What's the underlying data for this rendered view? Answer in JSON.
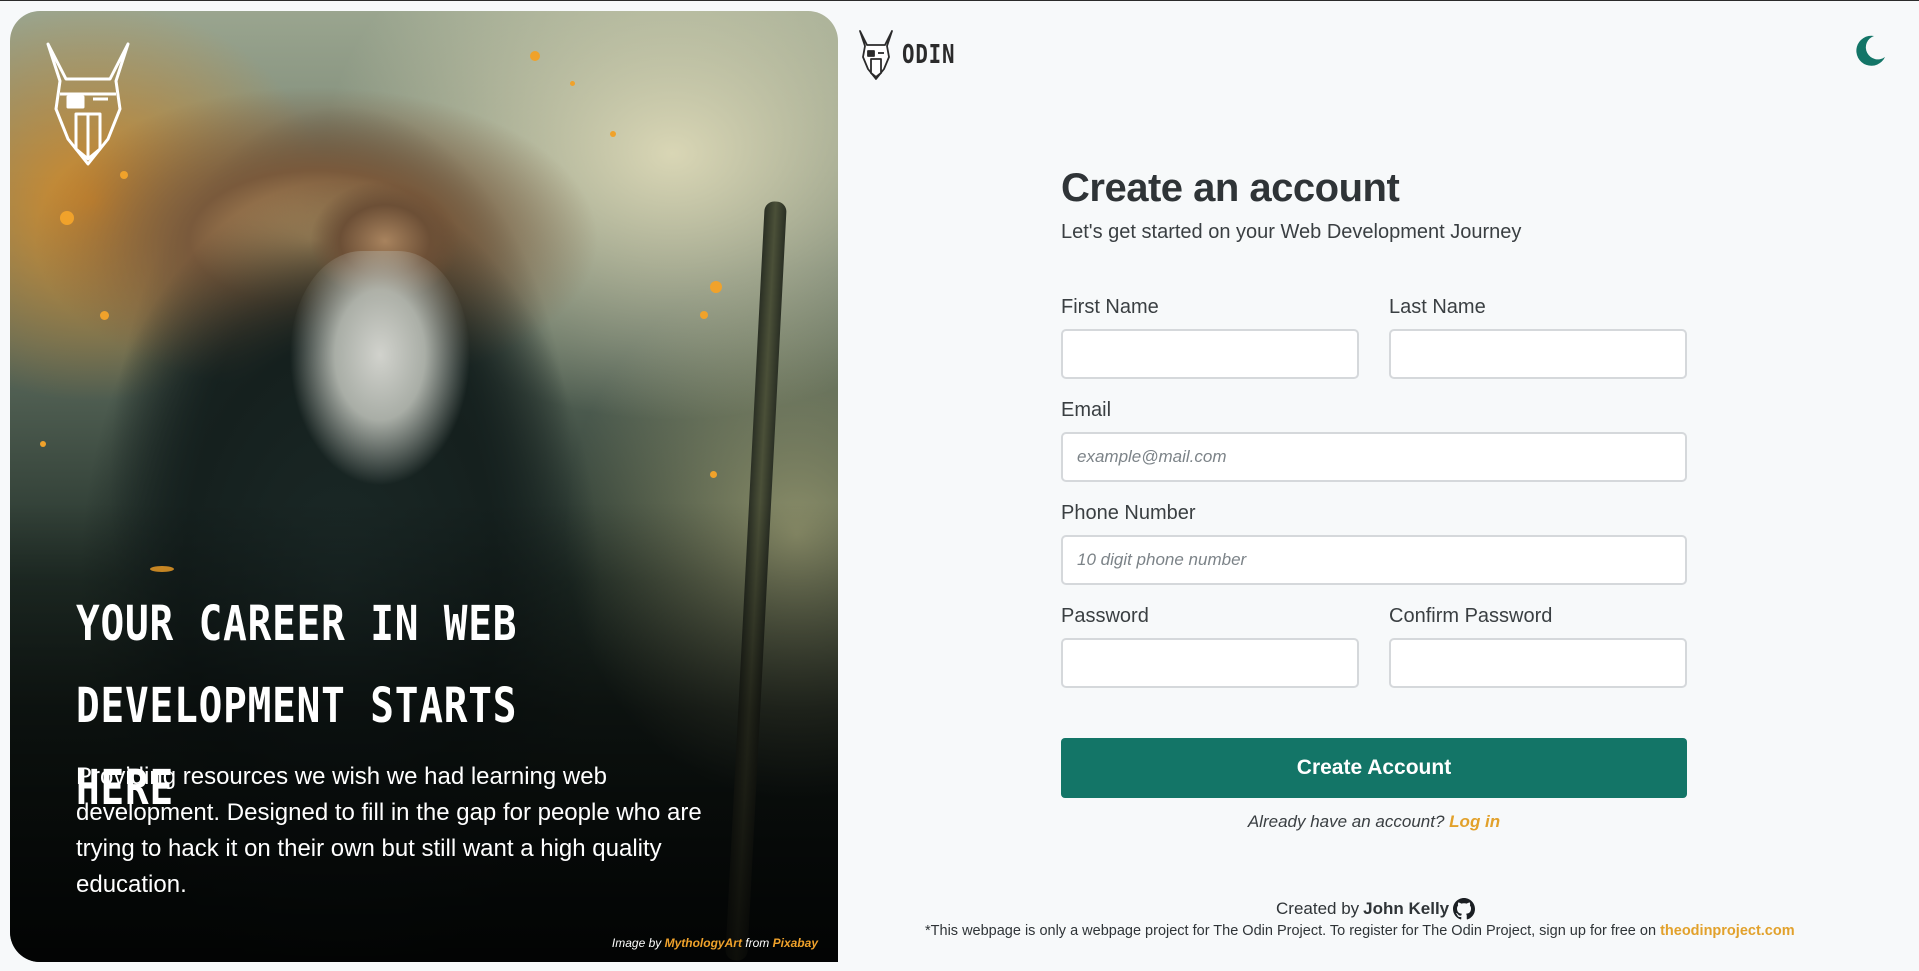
{
  "brand": {
    "name": "ODIN",
    "icon": "odin-helmet-icon"
  },
  "theme_toggle": {
    "icon": "moon-icon"
  },
  "hero": {
    "heading_line1": "YOUR CAREER IN WEB",
    "heading_line2": "DEVELOPMENT STARTS HERE",
    "description": "Providing resources we wish we had learning web development. Designed to fill in the gap for people who are trying to hack it on their own but still want a high quality education.",
    "credit": {
      "prefix": "Image by",
      "author": "MythologyArt",
      "middle": "from",
      "source": "Pixabay"
    }
  },
  "form": {
    "title": "Create an account",
    "subtitle": "Let's get started on your Web Development Journey",
    "fields": {
      "first_name": {
        "label": "First Name",
        "value": "",
        "placeholder": ""
      },
      "last_name": {
        "label": "Last Name",
        "value": "",
        "placeholder": ""
      },
      "email": {
        "label": "Email",
        "value": "",
        "placeholder": "example@mail.com"
      },
      "phone": {
        "label": "Phone Number",
        "value": "",
        "placeholder": "10 digit phone number"
      },
      "password": {
        "label": "Password",
        "value": "",
        "placeholder": ""
      },
      "confirm_password": {
        "label": "Confirm Password",
        "value": "",
        "placeholder": ""
      }
    },
    "submit_label": "Create Account",
    "login_prompt": "Already have an account?",
    "login_link": "Log in"
  },
  "footer": {
    "created_prefix": "Created by",
    "author": "John Kelly",
    "author_icon": "github-icon",
    "note": "*This webpage is only a webpage project for The Odin Project. To register for The Odin Project, sign up for free on",
    "note_link": "theodinproject.com"
  },
  "colors": {
    "accent": "#137567",
    "link": "#e2a12b",
    "background": "#f7f9fa"
  }
}
